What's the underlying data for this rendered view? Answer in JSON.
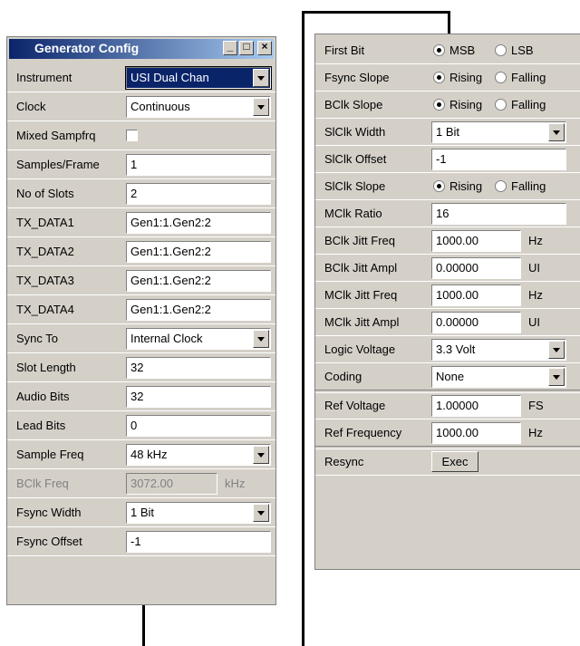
{
  "left": {
    "title": "Generator Config",
    "window_buttons": {
      "minimize": "_",
      "maximize": "□",
      "close": "×"
    },
    "rows": [
      {
        "label": "Instrument",
        "value": "USI Dual Chan",
        "kind": "dropdown"
      },
      {
        "label": "Clock",
        "value": "Continuous",
        "kind": "dropdown"
      },
      {
        "label": "Mixed Sampfrq",
        "kind": "checkbox",
        "checked": false
      },
      {
        "label": "Samples/Frame",
        "value": "1",
        "kind": "text"
      },
      {
        "label": "No of Slots",
        "value": "2",
        "kind": "text"
      },
      {
        "label": "TX_DATA1",
        "value": "Gen1:1.Gen2:2",
        "kind": "text"
      },
      {
        "label": "TX_DATA2",
        "value": "Gen1:1.Gen2:2",
        "kind": "text"
      },
      {
        "label": "TX_DATA3",
        "value": "Gen1:1.Gen2:2",
        "kind": "text"
      },
      {
        "label": "TX_DATA4",
        "value": "Gen1:1.Gen2:2",
        "kind": "text"
      },
      {
        "label": "Sync To",
        "value": "Internal Clock",
        "kind": "dropdown"
      },
      {
        "label": "Slot Length",
        "value": "32",
        "kind": "text"
      },
      {
        "label": "Audio Bits",
        "value": "32",
        "kind": "text"
      },
      {
        "label": "Lead Bits",
        "value": "0",
        "kind": "text"
      },
      {
        "label": "Sample Freq",
        "value": "48 kHz",
        "kind": "dropdown"
      },
      {
        "label": "BClk Freq",
        "value": "3072.00",
        "unit": "kHz",
        "kind": "disabled"
      },
      {
        "label": "Fsync Width",
        "value": "1 Bit",
        "kind": "dropdown"
      },
      {
        "label": "Fsync Offset",
        "value": "-1",
        "kind": "text"
      }
    ]
  },
  "right": {
    "rows": [
      {
        "label": "First Bit",
        "kind": "radio",
        "options": [
          "MSB",
          "LSB"
        ],
        "selected": 0
      },
      {
        "label": "Fsync Slope",
        "kind": "radio",
        "options": [
          "Rising",
          "Falling"
        ],
        "selected": 0
      },
      {
        "label": "BClk Slope",
        "kind": "radio",
        "options": [
          "Rising",
          "Falling"
        ],
        "selected": 0
      },
      {
        "label": "SlClk Width",
        "value": "1 Bit",
        "kind": "dropdown"
      },
      {
        "label": "SlClk Offset",
        "value": "-1",
        "kind": "text"
      },
      {
        "label": "SlClk Slope",
        "kind": "radio",
        "options": [
          "Rising",
          "Falling"
        ],
        "selected": 0
      },
      {
        "label": "MClk Ratio",
        "value": "16",
        "kind": "text"
      },
      {
        "label": "BClk Jitt Freq",
        "value": "1000.00",
        "unit": "Hz",
        "kind": "unit"
      },
      {
        "label": "BClk Jitt Ampl",
        "value": "0.00000",
        "unit": "UI",
        "kind": "unit"
      },
      {
        "label": "MClk Jitt Freq",
        "value": "1000.00",
        "unit": "Hz",
        "kind": "unit"
      },
      {
        "label": "MClk Jitt Ampl",
        "value": "0.00000",
        "unit": "UI",
        "kind": "unit"
      },
      {
        "label": "Logic Voltage",
        "value": "3.3 Volt",
        "kind": "dropdown"
      },
      {
        "label": "Coding",
        "value": "None",
        "kind": "dropdown"
      },
      {
        "kind": "separator"
      },
      {
        "label": "Ref Voltage",
        "value": "1.00000",
        "unit": "FS",
        "kind": "unit"
      },
      {
        "label": "Ref Frequency",
        "value": "1000.00",
        "unit": "Hz",
        "kind": "unit"
      },
      {
        "kind": "separator"
      },
      {
        "label": "Resync",
        "value": "Exec",
        "kind": "button"
      }
    ]
  },
  "colors": {
    "panel_bg": "#d4d0c8",
    "title_start": "#0a246a",
    "title_end": "#a6caf0",
    "focus": "#0a246a"
  }
}
